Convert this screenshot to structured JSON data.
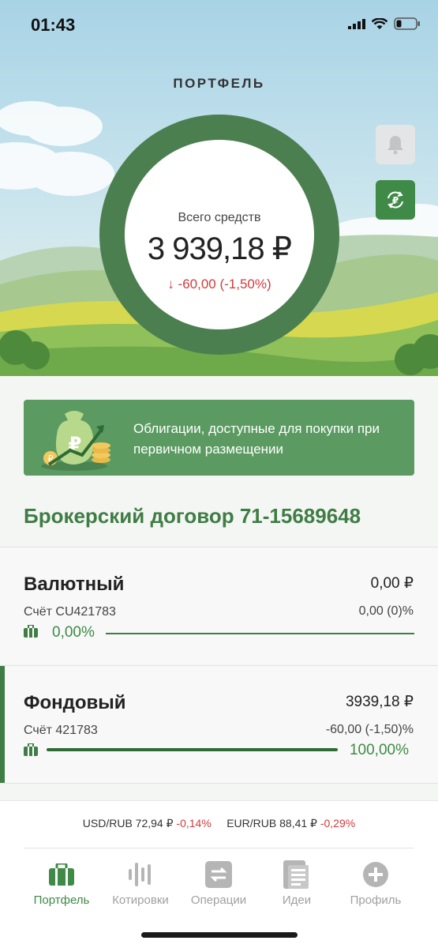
{
  "status_bar": {
    "time": "01:43"
  },
  "header": {
    "title": "ПОРТФЕЛЬ"
  },
  "portfolio": {
    "total_label": "Всего средств",
    "total_value": "3 939,18 ₽",
    "change": "-60,00 (-1,50%)",
    "change_color": "#d23b3b",
    "ring_color": "#4b7f4f"
  },
  "banner": {
    "text": "Облигации, доступные для покупки при первичном размещении"
  },
  "contract": {
    "title": "Брокерский договор 71-15689648"
  },
  "accounts": [
    {
      "name": "Валютный",
      "account": "Счёт CU421783",
      "sum": "0,00 ₽",
      "change": "0,00 (0)%",
      "share_label": "0,00%",
      "share": 0.0
    },
    {
      "name": "Фондовый",
      "account": "Счёт 421783",
      "sum": "3939,18 ₽",
      "change": "-60,00 (-1,50)%",
      "share_label": "100,00%",
      "share": 1.0
    }
  ],
  "rates": [
    {
      "pair": "USD/RUB 72,94 ₽",
      "change": "-0,14%"
    },
    {
      "pair": "EUR/RUB 88,41 ₽",
      "change": "-0,29%"
    }
  ],
  "tabs": [
    {
      "label": "Портфель",
      "icon": "briefcase-icon",
      "active": true
    },
    {
      "label": "Котировки",
      "icon": "quotes-icon",
      "active": false
    },
    {
      "label": "Операции",
      "icon": "operations-icon",
      "active": false
    },
    {
      "label": "Идеи",
      "icon": "ideas-icon",
      "active": false
    },
    {
      "label": "Профиль",
      "icon": "profile-plus-icon",
      "active": false
    }
  ],
  "colors": {
    "accent": "#3f8a46",
    "negative": "#d23b3b",
    "banner": "#5b9b62"
  }
}
